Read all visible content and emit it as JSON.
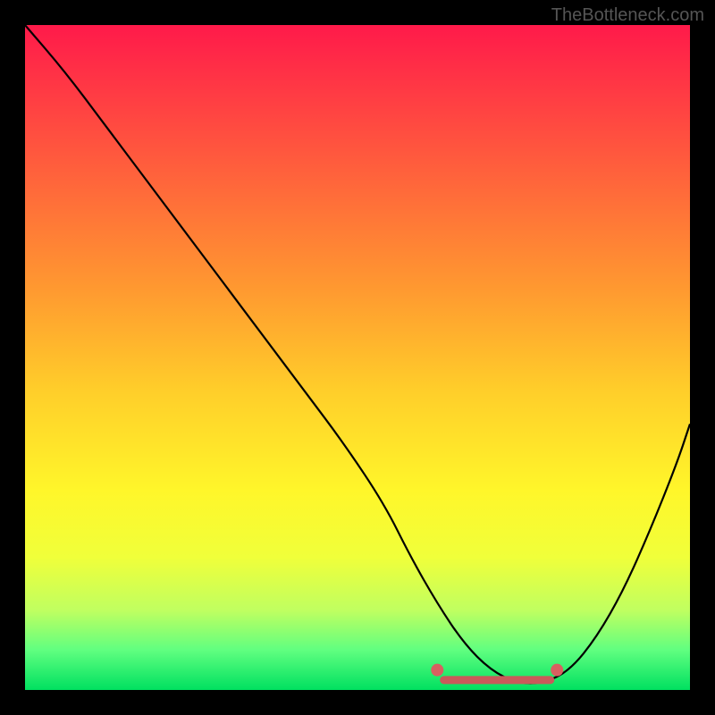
{
  "watermark": "TheBottleneck.com",
  "chart_data": {
    "type": "line",
    "title": "",
    "xlabel": "",
    "ylabel": "",
    "xlim": [
      0,
      100
    ],
    "ylim": [
      0,
      100
    ],
    "series": [
      {
        "name": "bottleneck-curve",
        "x": [
          0,
          6,
          12,
          18,
          24,
          30,
          36,
          42,
          48,
          54,
          58,
          62,
          66,
          70,
          74,
          78,
          82,
          86,
          90,
          94,
          98,
          100
        ],
        "values": [
          100,
          93,
          85,
          77,
          69,
          61,
          53,
          45,
          37,
          28,
          20,
          13,
          7,
          3,
          1,
          1,
          3,
          8,
          15,
          24,
          34,
          40
        ]
      }
    ],
    "markers": [
      {
        "name": "trough-left",
        "x": 62,
        "y": 3,
        "color": "#d86060"
      },
      {
        "name": "trough-right",
        "x": 80,
        "y": 3,
        "color": "#d86060"
      }
    ],
    "trough_band": {
      "x_start": 63,
      "x_end": 79,
      "y": 1.5,
      "color": "#c85a5a"
    },
    "background_gradient": {
      "top": "#ff1a4a",
      "bottom": "#00e060"
    }
  }
}
